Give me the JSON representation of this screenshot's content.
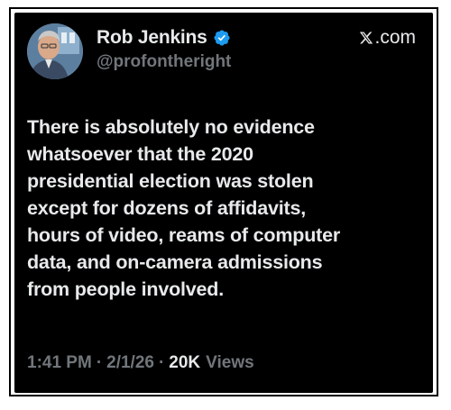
{
  "author": {
    "display_name": "Rob Jenkins",
    "handle": "@profontheright",
    "verified": true,
    "verified_color": "#1d9bf0",
    "avatar_icon": "profile-photo"
  },
  "brand": {
    "label": ".com",
    "icon": "x-logo-icon"
  },
  "post": {
    "text": "There is absolutely no evidence\nwhatsoever that the 2020\npresidential election was stolen\nexcept for dozens of affidavits,\nhours of video, reams of computer\ndata, and on-camera admissions\nfrom people involved."
  },
  "meta": {
    "time": "1:41 PM",
    "separator": "·",
    "date": "2/1/26",
    "views_count": "20K",
    "views_label": "Views"
  },
  "colors": {
    "background": "#000000",
    "text_primary": "#e7e9ea",
    "text_secondary": "#71767b"
  }
}
